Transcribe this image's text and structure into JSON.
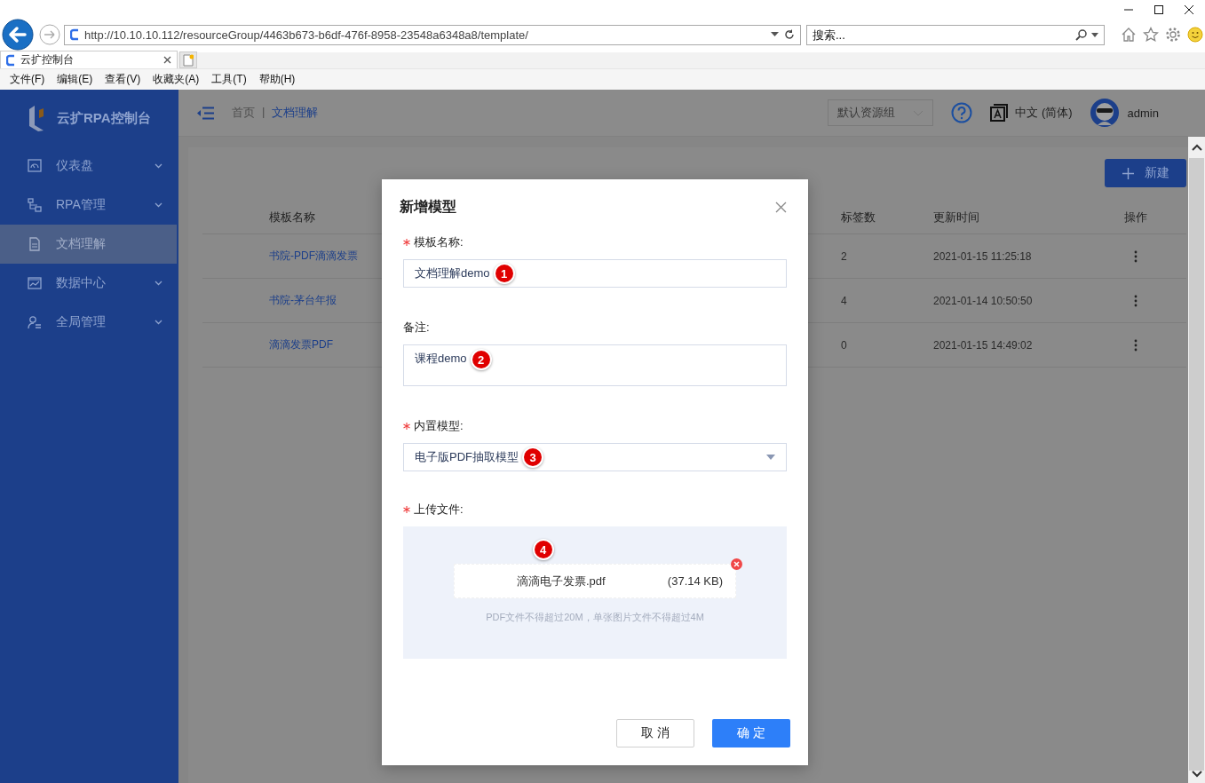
{
  "browser": {
    "address": "http://10.10.10.112/resourceGroup/4463b673-b6df-476f-8958-23548a6348a8/template/",
    "search": {
      "placeholder": "搜索..."
    },
    "tabs": [
      {
        "label": "云扩控制台",
        "selected": true
      }
    ],
    "menu": [
      "文件(F)",
      "编辑(E)",
      "查看(V)",
      "收藏夹(A)",
      "工具(T)",
      "帮助(H)"
    ]
  },
  "sidebar": {
    "title": "云扩RPA控制台",
    "items": [
      {
        "label": "仪表盘",
        "selected": false,
        "expandable": true
      },
      {
        "label": "RPA管理",
        "selected": false,
        "expandable": true
      },
      {
        "label": "文档理解",
        "selected": true,
        "expandable": false
      },
      {
        "label": "数据中心",
        "selected": false,
        "expandable": true
      },
      {
        "label": "全局管理",
        "selected": false,
        "expandable": true
      }
    ]
  },
  "topbar": {
    "breadcrumb": [
      "首页",
      "|",
      "文档理解"
    ],
    "resource_group": "默认资源组",
    "language": "中文 (简体)",
    "user": "admin"
  },
  "new_button": "新建",
  "table": {
    "columns": [
      "模板名称",
      "标签数",
      "更新时间",
      "操作"
    ],
    "rows": [
      {
        "name": "书院-PDF滴滴发票",
        "tags": "2",
        "updated": "2021-01-15 11:25:18"
      },
      {
        "name": "书院-茅台年报",
        "tags": "4",
        "updated": "2021-01-14 10:50:50"
      },
      {
        "name": "滴滴发票PDF",
        "tags": "0",
        "updated": "2021-01-15 14:49:02"
      }
    ]
  },
  "dialog": {
    "title": "新增模型",
    "fields": [
      {
        "kind": "input",
        "label": "模板名称:",
        "required": true,
        "value": "文档理解demo",
        "marker": "1"
      },
      {
        "kind": "textarea",
        "label": "备注:",
        "required": false,
        "value": "课程demo",
        "marker": "2"
      },
      {
        "kind": "select",
        "label": "内置模型:",
        "required": true,
        "value": "电子版PDF抽取模型",
        "marker": "3"
      },
      {
        "kind": "upload",
        "label": "上传文件:",
        "required": true,
        "marker": "4",
        "file": {
          "name": "滴滴电子发票.pdf",
          "size": "(37.14 KB)"
        },
        "hint": "PDF文件不得超过20M，单张图片文件不得超过4M"
      }
    ],
    "buttons": [
      {
        "label": "取 消",
        "primary": false
      },
      {
        "label": "确 定",
        "primary": true
      }
    ]
  }
}
